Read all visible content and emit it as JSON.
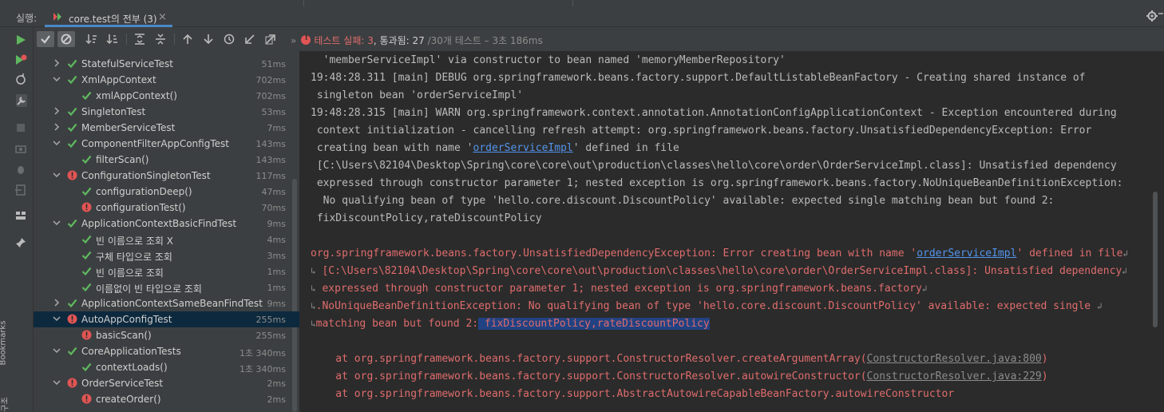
{
  "header": {
    "run_label": "실행:",
    "tab_label": "core.test의 전부 (3)",
    "close_glyph": "×"
  },
  "toolbar": {
    "status": {
      "prefix": "테스트 실패: 3",
      "passed": ", 통과됨: 27",
      "total": " /30개 테스트 – 3초 186ms"
    }
  },
  "tree": {
    "items": [
      {
        "name": "StatefulServiceTest",
        "duration": "51ms",
        "status": "pass",
        "level": 0,
        "expanded": false
      },
      {
        "name": "XmlAppContext",
        "duration": "702ms",
        "status": "pass",
        "level": 0,
        "expanded": true
      },
      {
        "name": "xmlAppContext()",
        "duration": "702ms",
        "status": "pass",
        "level": 1
      },
      {
        "name": "SingletonTest",
        "duration": "53ms",
        "status": "pass",
        "level": 0,
        "expanded": false
      },
      {
        "name": "MemberServiceTest",
        "duration": "7ms",
        "status": "pass",
        "level": 0,
        "expanded": false
      },
      {
        "name": "ComponentFilterAppConfigTest",
        "duration": "143ms",
        "status": "pass",
        "level": 0,
        "expanded": true
      },
      {
        "name": "filterScan()",
        "duration": "143ms",
        "status": "pass",
        "level": 1
      },
      {
        "name": "ConfigurationSingletonTest",
        "duration": "117ms",
        "status": "fail",
        "level": 0,
        "expanded": true
      },
      {
        "name": "configurationDeep()",
        "duration": "47ms",
        "status": "pass",
        "level": 1
      },
      {
        "name": "configurationTest()",
        "duration": "70ms",
        "status": "fail",
        "level": 1
      },
      {
        "name": "ApplicationContextBasicFindTest",
        "duration": "9ms",
        "status": "pass",
        "level": 0,
        "expanded": true
      },
      {
        "name": "빈 이름으로 조회 X",
        "duration": "4ms",
        "status": "pass",
        "level": 1
      },
      {
        "name": "구체 타입으로 조회",
        "duration": "3ms",
        "status": "pass",
        "level": 1
      },
      {
        "name": "빈 이름으로 조회",
        "duration": "1ms",
        "status": "pass",
        "level": 1
      },
      {
        "name": "이름없이 빈 타입으로 조회",
        "duration": "1ms",
        "status": "pass",
        "level": 1
      },
      {
        "name": "ApplicationContextSameBeanFindTest",
        "duration": "9ms",
        "status": "pass",
        "level": 0,
        "expanded": false
      },
      {
        "name": "AutoAppConfigTest",
        "duration": "255ms",
        "status": "fail",
        "level": 0,
        "expanded": true,
        "selected": true
      },
      {
        "name": "basicScan()",
        "duration": "255ms",
        "status": "fail",
        "level": 1
      },
      {
        "name": "CoreApplicationTests",
        "duration": "1초 340ms",
        "status": "pass",
        "level": 0,
        "expanded": true
      },
      {
        "name": "contextLoads()",
        "duration": "1초 340ms",
        "status": "pass",
        "level": 1
      },
      {
        "name": "OrderServiceTest",
        "duration": "2ms",
        "status": "fail",
        "level": 0,
        "expanded": true
      },
      {
        "name": "createOrder()",
        "duration": "2ms",
        "status": "fail",
        "level": 1
      }
    ]
  },
  "console": {
    "lines": [
      {
        "segments": [
          {
            "t": "  'memberServiceImpl' via constructor to bean named 'memoryMemberRepository'"
          }
        ]
      },
      {
        "segments": [
          {
            "t": "19:48:28.311 [main] DEBUG org.springframework.beans.factory.support.DefaultListableBeanFactory - Creating shared instance of"
          }
        ]
      },
      {
        "segments": [
          {
            "t": " singleton bean 'orderServiceImpl'"
          }
        ]
      },
      {
        "segments": [
          {
            "t": "19:48:28.315 [main] WARN org.springframework.context.annotation.AnnotationConfigApplicationContext - Exception encountered during"
          }
        ]
      },
      {
        "segments": [
          {
            "t": " context initialization - cancelling refresh attempt: org.springframework.beans.factory.UnsatisfiedDependencyException: Error"
          }
        ]
      },
      {
        "segments": [
          {
            "t": " creating bean with name '"
          },
          {
            "t": "orderServiceImpl",
            "c": "link"
          },
          {
            "t": "' defined in file"
          }
        ]
      },
      {
        "segments": [
          {
            "t": " [C:\\Users\\82104\\Desktop\\Spring\\core\\core\\out\\production\\classes\\hello\\core\\order\\OrderServiceImpl.class]: Unsatisfied dependency"
          }
        ]
      },
      {
        "segments": [
          {
            "t": " expressed through constructor parameter 1; nested exception is org.springframework.beans.factory.NoUniqueBeanDefinitionException:"
          }
        ]
      },
      {
        "segments": [
          {
            "t": "  No qualifying bean of type 'hello.core.discount.DiscountPolicy' available: expected single matching bean but found 2:"
          }
        ]
      },
      {
        "segments": [
          {
            "t": " fixDiscountPolicy,rateDiscountPolicy"
          }
        ]
      },
      {
        "segments": [
          {
            "t": ""
          }
        ]
      },
      {
        "err": true,
        "segments": [
          {
            "t": "org.springframework.beans.factory.UnsatisfiedDependencyException: Error creating bean with name '"
          },
          {
            "t": "orderServiceImpl",
            "c": "link"
          },
          {
            "t": "' defined in file"
          },
          {
            "t": "↲",
            "c": "wrap-mark"
          }
        ]
      },
      {
        "err": true,
        "segments": [
          {
            "t": "↳",
            "c": "wrap-mark"
          },
          {
            "t": " [C:\\Users\\82104\\Desktop\\Spring\\core\\core\\out\\production\\classes\\hello\\core\\order\\OrderServiceImpl.class]: Unsatisfied dependency"
          },
          {
            "t": "↲",
            "c": "wrap-mark"
          }
        ]
      },
      {
        "err": true,
        "segments": [
          {
            "t": "↳",
            "c": "wrap-mark"
          },
          {
            "t": " expressed through constructor parameter 1; nested exception is org.springframework.beans.factory"
          },
          {
            "t": "↲",
            "c": "wrap-mark"
          }
        ]
      },
      {
        "err": true,
        "segments": [
          {
            "t": "↳",
            "c": "wrap-mark"
          },
          {
            "t": ".NoUniqueBeanDefinitionException: No qualifying bean of type 'hello.core.discount.DiscountPolicy' available: expected single "
          },
          {
            "t": "↲",
            "c": "wrap-mark"
          }
        ]
      },
      {
        "err": true,
        "segments": [
          {
            "t": "↳",
            "c": "wrap-mark"
          },
          {
            "t": "matching bean but found 2:"
          },
          {
            "t": " fixDiscountPolicy,rateDiscountPolicy",
            "c": "sel"
          }
        ]
      },
      {
        "segments": [
          {
            "t": ""
          }
        ]
      },
      {
        "err": true,
        "segments": [
          {
            "t": "    at org.springframework.beans.factory.support.ConstructorResolver.createArgumentArray("
          },
          {
            "t": "ConstructorResolver.java:800",
            "c": "gray-link"
          },
          {
            "t": ")"
          }
        ]
      },
      {
        "err": true,
        "segments": [
          {
            "t": "    at org.springframework.beans.factory.support.ConstructorResolver.autowireConstructor("
          },
          {
            "t": "ConstructorResolver.java:229",
            "c": "gray-link"
          },
          {
            "t": ")"
          }
        ]
      },
      {
        "err": true,
        "segments": [
          {
            "t": "    at org.springframework.beans.factory.support.AbstractAutowireCapableBeanFactory.autowireConstructor"
          }
        ]
      }
    ]
  },
  "side_tabs": {
    "bookmarks": "Bookmarks",
    "structure": "구조"
  },
  "colors": {
    "pass": "#5fb85f",
    "fail": "#e05555",
    "accent": "#4a88c7",
    "link": "#5394ec",
    "error_text": "#e06c6c",
    "selection": "#214283"
  }
}
